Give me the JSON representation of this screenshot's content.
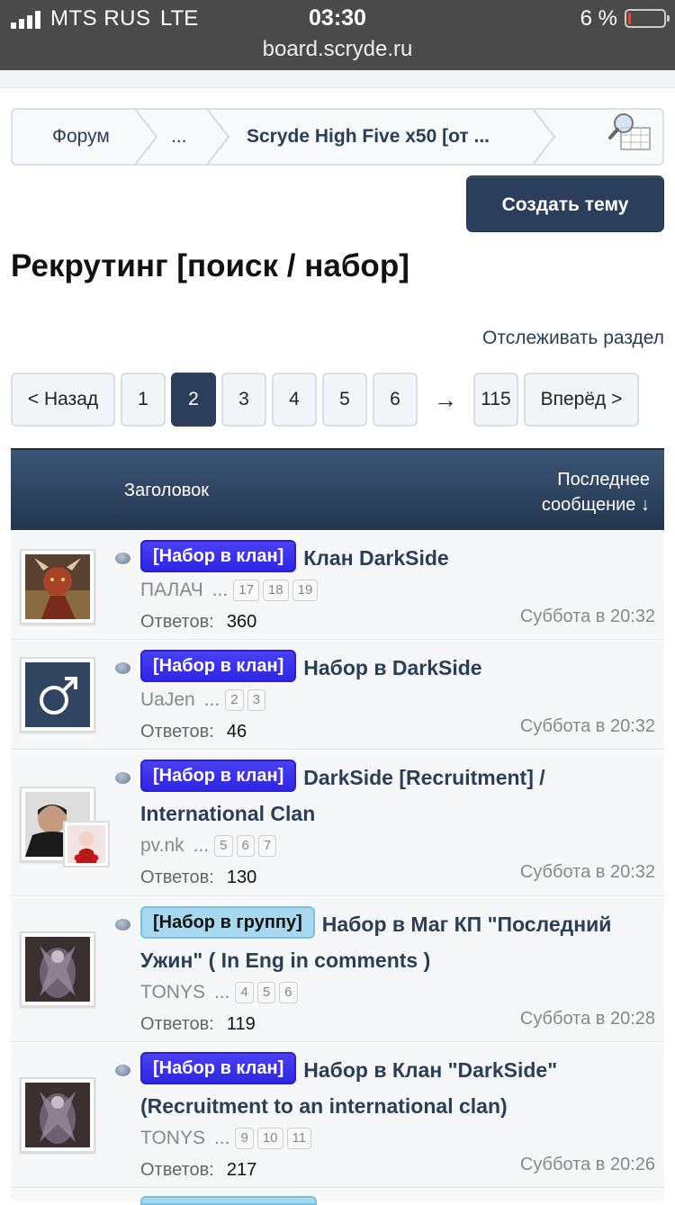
{
  "status_bar": {
    "carrier": "MTS RUS",
    "network": "LTE",
    "time": "03:30",
    "battery_percent": "6 %",
    "battery_level": 0.06,
    "url": "board.scryde.ru"
  },
  "breadcrumb": {
    "items": [
      "Форум",
      "...",
      "Scryde High Five x50 [от ..."
    ]
  },
  "create_topic_label": "Создать тему",
  "page_title": "Рекрутинг [поиск / набор]",
  "watch_label": "Отслеживать раздел",
  "pagination": {
    "prev": "< Назад",
    "pages": [
      "1",
      "2",
      "3",
      "4",
      "5",
      "6"
    ],
    "current": "2",
    "arrow": "→",
    "last": "115",
    "next": "Вперёд >"
  },
  "table_header": {
    "title": "Заголовок",
    "last_post_line1": "Последнее",
    "last_post_line2": "сообщение ↓"
  },
  "replies_label": "Ответов:",
  "threads": [
    {
      "prefix": "[Набор в клан]",
      "prefix_type": "clan",
      "title": "Клан DarkSide",
      "author": "ПАЛАЧ",
      "ellipsis": "...",
      "pages": [
        "17",
        "18",
        "19"
      ],
      "replies": "360",
      "last_post": "Суббота в 20:32"
    },
    {
      "prefix": "[Набор в клан]",
      "prefix_type": "clan",
      "title": "Набор в DarkSide",
      "author": "UaJen",
      "ellipsis": "...",
      "pages": [
        "2",
        "3"
      ],
      "replies": "46",
      "last_post": "Суббота в 20:32"
    },
    {
      "prefix": "[Набор в клан]",
      "prefix_type": "clan",
      "title": "DarkSide [Recruitment] /",
      "title2": "International Clan",
      "author": "pv.nk",
      "ellipsis": "...",
      "pages": [
        "5",
        "6",
        "7"
      ],
      "replies": "130",
      "last_post": "Суббота в 20:32"
    },
    {
      "prefix": "[Набор в группу]",
      "prefix_type": "group",
      "title": "Набор в Маг КП \"Последний",
      "title2": "Ужин\" ( In Eng in comments )",
      "author": "TONYS",
      "ellipsis": "...",
      "pages": [
        "4",
        "5",
        "6"
      ],
      "replies": "119",
      "last_post": "Суббота в 20:28"
    },
    {
      "prefix": "[Набор в клан]",
      "prefix_type": "clan",
      "title": "Набор в Клан \"DarkSide\"",
      "title2": "(Recruitment to an international clan)",
      "author": "TONYS",
      "ellipsis": "...",
      "pages": [
        "9",
        "10",
        "11"
      ],
      "replies": "217",
      "last_post": "Суббота в 20:26"
    }
  ]
}
